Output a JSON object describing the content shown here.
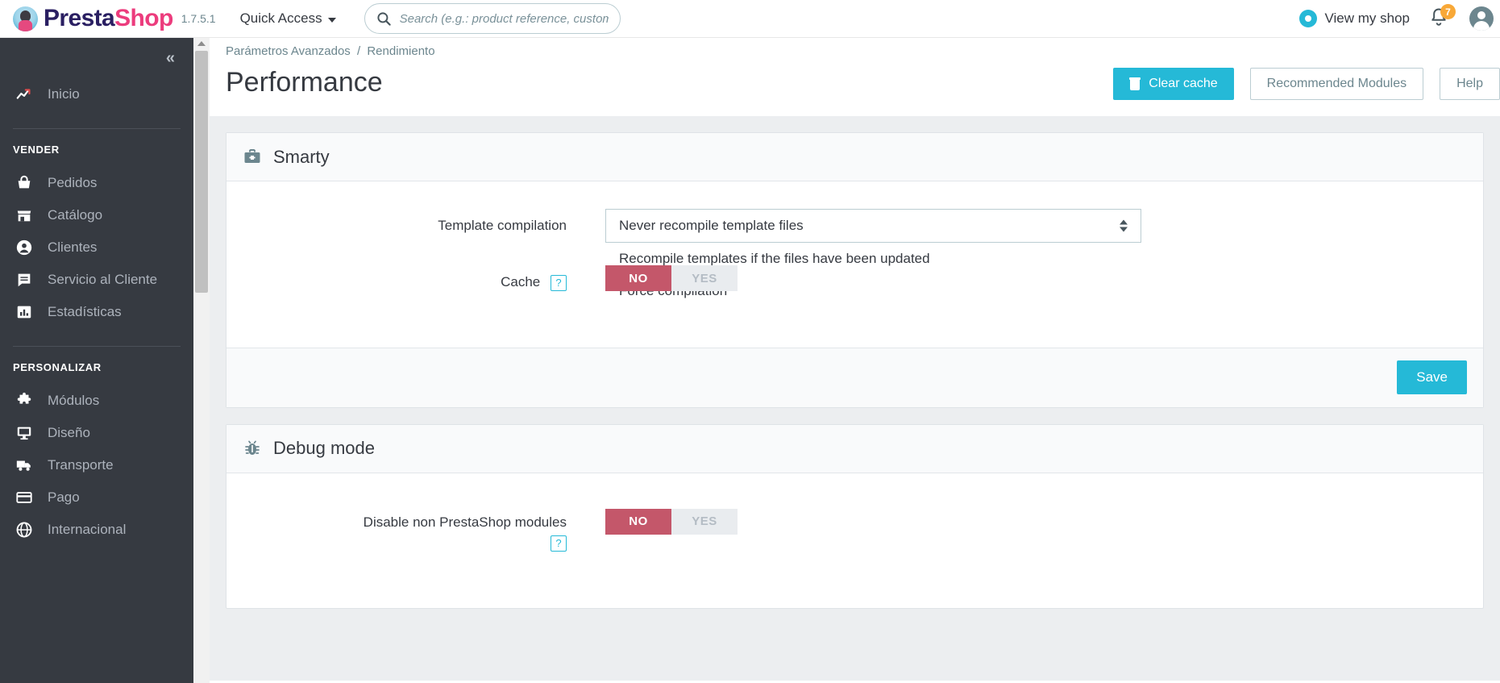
{
  "header": {
    "brand_primary": "Presta",
    "brand_secondary": "Shop",
    "version": "1.7.5.1",
    "quick_access": "Quick Access",
    "search_placeholder": "Search (e.g.: product reference, custome",
    "search_value": "",
    "view_shop": "View my shop",
    "notification_count": "7"
  },
  "sidebar": {
    "collapse_label": "«",
    "home": {
      "label": "Inicio",
      "icon": "trend-up-icon"
    },
    "groups": [
      {
        "title": "VENDER",
        "items": [
          {
            "label": "Pedidos",
            "icon": "basket-icon"
          },
          {
            "label": "Catálogo",
            "icon": "store-icon"
          },
          {
            "label": "Clientes",
            "icon": "user-icon"
          },
          {
            "label": "Servicio al Cliente",
            "icon": "chat-icon"
          },
          {
            "label": "Estadísticas",
            "icon": "bar-chart-icon"
          }
        ]
      },
      {
        "title": "PERSONALIZAR",
        "items": [
          {
            "label": "Módulos",
            "icon": "puzzle-icon"
          },
          {
            "label": "Diseño",
            "icon": "monitor-icon"
          },
          {
            "label": "Transporte",
            "icon": "truck-icon"
          },
          {
            "label": "Pago",
            "icon": "credit-card-icon"
          },
          {
            "label": "Internacional",
            "icon": "globe-icon"
          }
        ]
      }
    ]
  },
  "content": {
    "breadcrumb": {
      "parent": "Parámetros Avanzados",
      "separator": "/",
      "current": "Rendimiento"
    },
    "page_title": "Performance",
    "toolbar": {
      "clear_cache": "Clear cache",
      "recommended_modules": "Recommended Modules",
      "help": "Help"
    },
    "smarty_panel": {
      "title": "Smarty",
      "icon": "toolbox-icon",
      "template_compilation": {
        "label": "Template compilation",
        "selected": "Never recompile template files",
        "options": [
          "Never recompile template files",
          "Recompile templates if the files have been updated",
          "Force compilation"
        ]
      },
      "cache": {
        "label": "Cache",
        "help_icon": "?",
        "no_label": "NO",
        "yes_label": "YES",
        "value": "NO"
      },
      "save_label": "Save"
    },
    "debug_panel": {
      "title": "Debug mode",
      "icon": "bug-icon",
      "disable_modules": {
        "label": "Disable non PrestaShop modules",
        "help_icon": "?",
        "no_label": "NO",
        "yes_label": "YES",
        "value": "NO"
      }
    }
  },
  "colors": {
    "accent": "#25b9d7",
    "sidebar_bg": "#363a41",
    "toggle_no": "#c4576a",
    "badge": "#f8a837",
    "brand_pink": "#ec3c7d",
    "brand_navy": "#2a1f62"
  }
}
